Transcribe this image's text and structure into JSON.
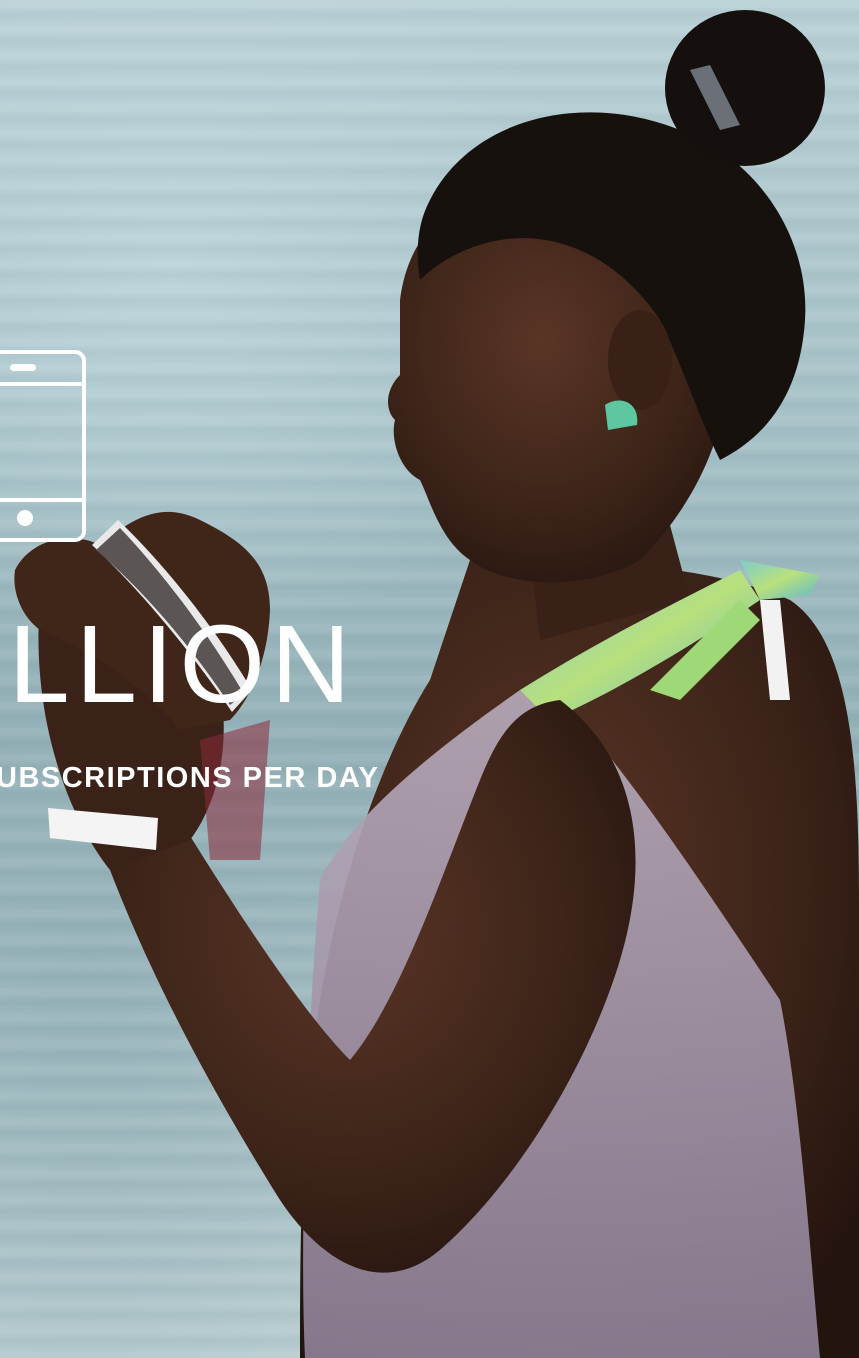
{
  "stat": {
    "number_text": "ILLION",
    "caption": "UBSCRIPTIONS PER DAY"
  },
  "icons": {
    "phone": "smartphone-outline-icon"
  },
  "colors": {
    "text": "#ffffff",
    "sea": "#a7c2c8",
    "skin": "#3b2218",
    "hair": "#16100d"
  }
}
